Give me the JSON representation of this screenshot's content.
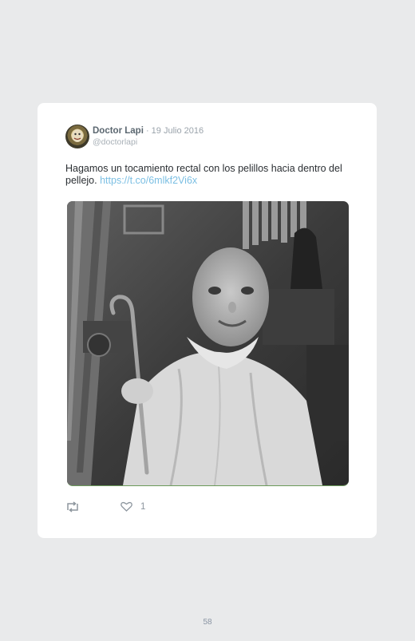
{
  "tweet": {
    "author_name": "Doctor Lapi",
    "separator": " · ",
    "date": "19 Julio 2016",
    "handle": "@doctorlapi",
    "text": "Hagamos un tocamiento rectal con los pelillos hacia dentro del pellejo. ",
    "link": "https://t.co/6mlkf2Vi6x",
    "like_count": "1"
  },
  "icons": {
    "retweet": "retweet-icon",
    "like": "heart-icon",
    "avatar": "avatar"
  },
  "page": {
    "number": "58"
  }
}
